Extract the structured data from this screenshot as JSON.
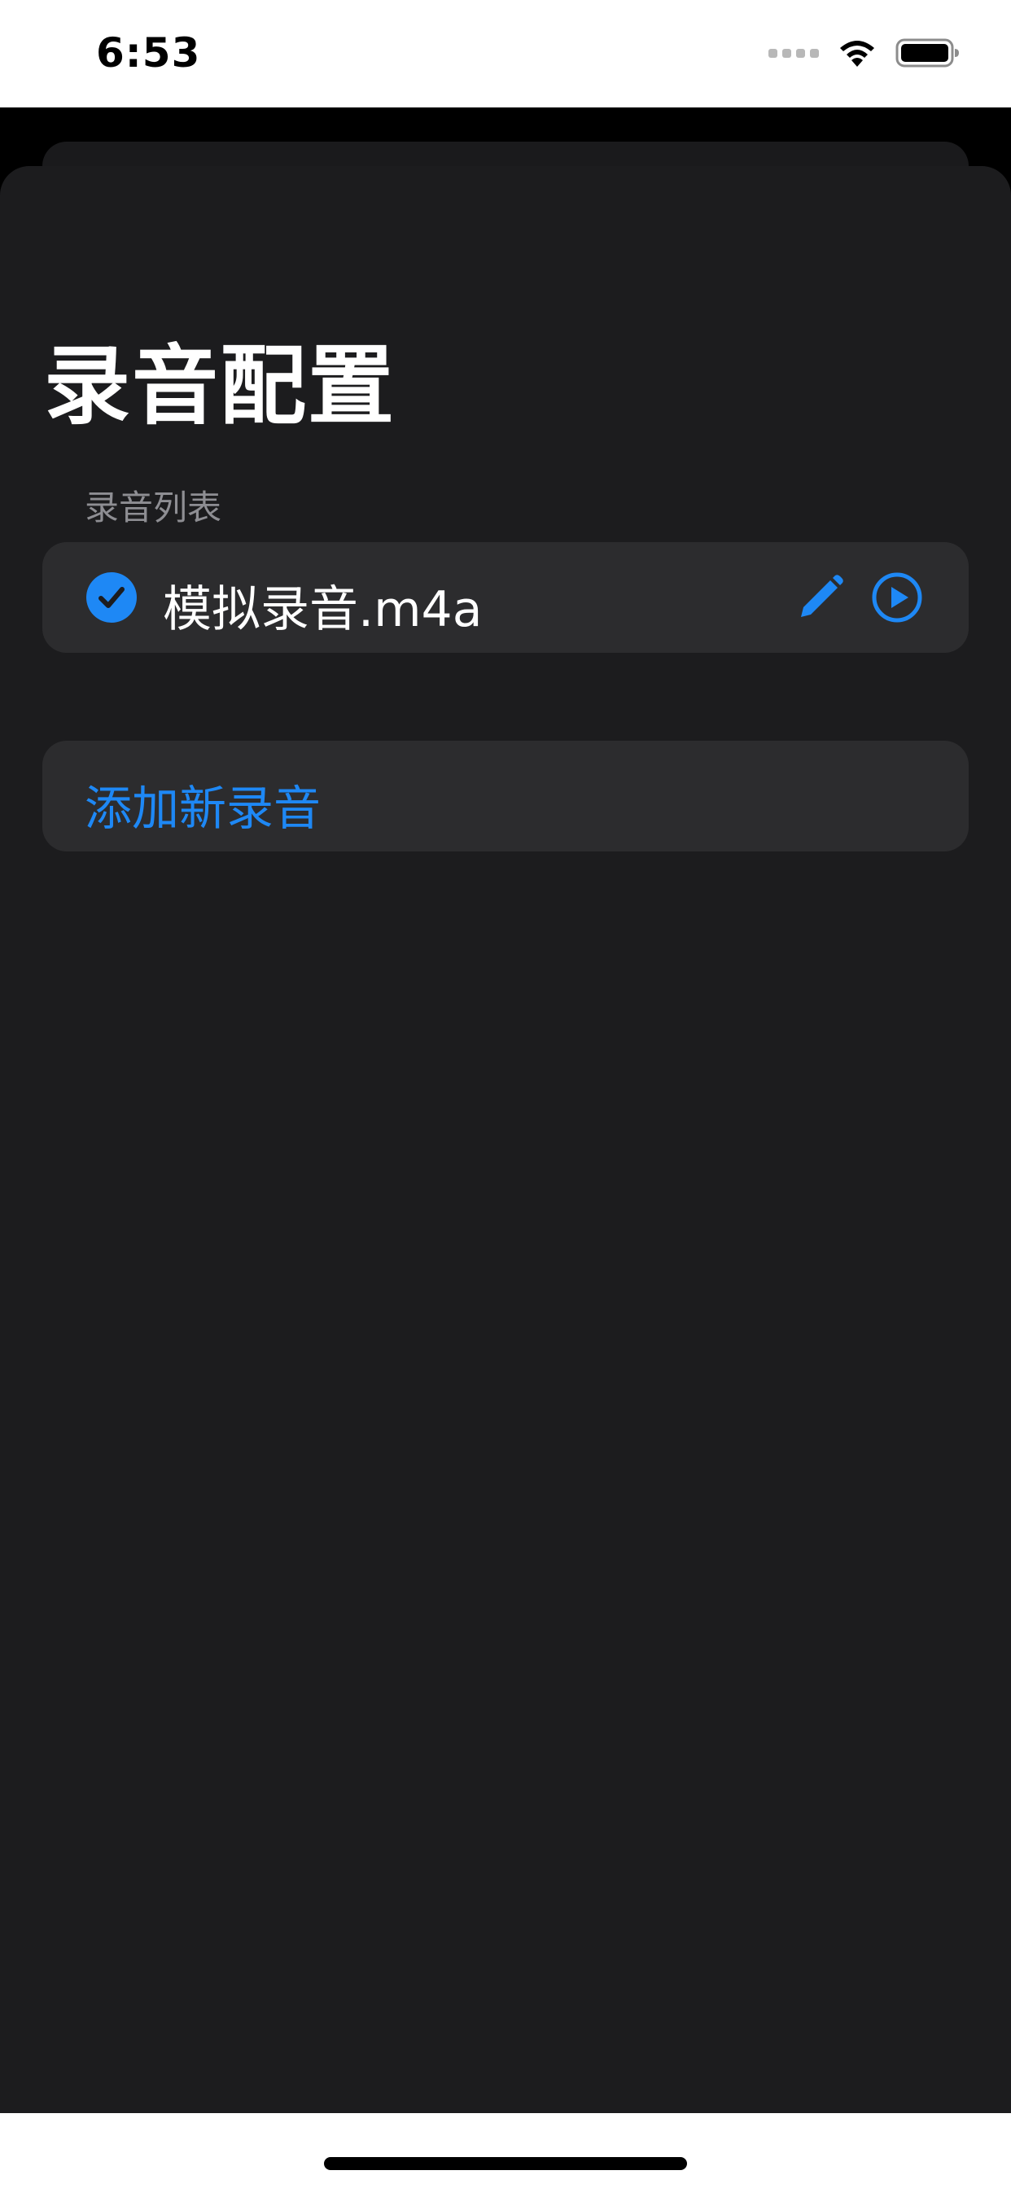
{
  "status_bar": {
    "time": "6:53"
  },
  "page": {
    "title": "录音配置",
    "section_header": "录音列表"
  },
  "recordings": [
    {
      "name": "模拟录音.m4a",
      "selected": true
    }
  ],
  "actions": {
    "add_label": "添加新录音"
  },
  "icons": {
    "check": "checkmark-circle-fill-icon",
    "edit": "pencil-icon",
    "play": "play-circle-icon",
    "wifi": "wifi-icon",
    "battery": "battery-icon"
  },
  "colors": {
    "accent": "#1e88f5",
    "sheet_background": "#1c1c1e",
    "row_background": "#2c2c2e",
    "secondary_text": "#8e8e93"
  }
}
